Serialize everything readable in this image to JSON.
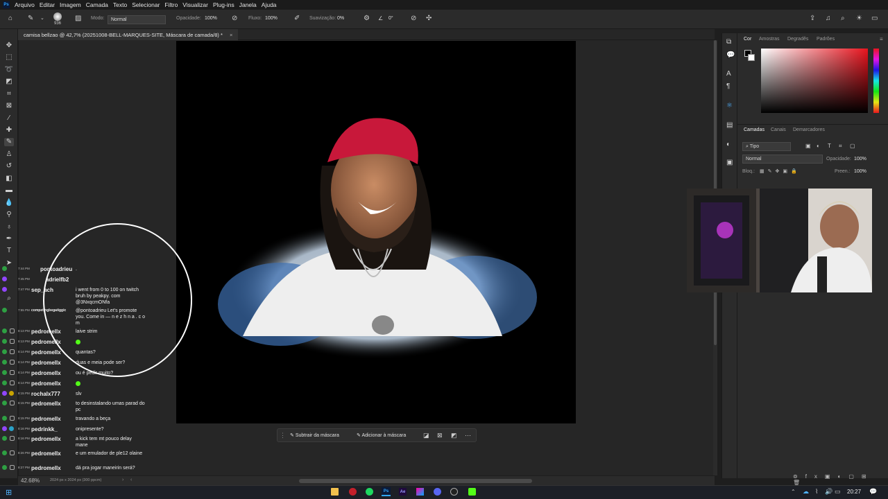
{
  "menu": [
    "Arquivo",
    "Editar",
    "Imagem",
    "Camada",
    "Texto",
    "Selecionar",
    "Filtro",
    "Visualizar",
    "Plug-ins",
    "Janela",
    "Ajuda"
  ],
  "options": {
    "brush_size": "936",
    "mode_label": "Modo:",
    "mode_value": "Normal",
    "opacity_label": "Opacidade:",
    "opacity_value": "100%",
    "flow_label": "Fluxo:",
    "flow_value": "100%",
    "smoothing_label": "Suavização:",
    "smoothing_value": "0%",
    "angle_value": "0°"
  },
  "document": {
    "tab_title": "camisa bellzao @ 42,7% (20251008-BELL-MARQUES-SITE, Máscara de camada/8) *",
    "zoom": "42.68%",
    "info": "2024 px x 2024 px (300 ppcm)"
  },
  "mask_toolbar": {
    "subtract": "Subtrair da máscara",
    "add": "Adicionar à máscara"
  },
  "color_panel": {
    "tabs": [
      "Cor",
      "Amostras",
      "Degradês",
      "Padrões"
    ],
    "hue_color": "#e8141e"
  },
  "layers_panel": {
    "tabs": [
      "Camadas",
      "Canais",
      "Demarcadores"
    ],
    "filter_type": "Tipo",
    "blend_mode": "Normal",
    "opacity_label": "Opacidade:",
    "opacity_value": "100%",
    "lock_label": "Bloq.:",
    "fill_label": "Preen.:",
    "fill_value": "100%"
  },
  "chat": [
    {
      "time": "7:44 PM",
      "user": "pontoadrieu",
      "msg": ".",
      "color": "#e0e0e0"
    },
    {
      "time": "7:45 PM",
      "user": "adrielfb2",
      "msg": "",
      "color": "#e0e0e0"
    },
    {
      "time": "7:47 PM",
      "user": "sep_ach",
      "msg": "i went from 0 to 100 on twitch bruh by peakpy. com      @3NxqcmONfa"
    },
    {
      "time": "7:55 PM",
      "user": "competingbegatiggic",
      "msg": "@pontoadrieu Let's promote you. Come in — n e z h n a . c o m"
    },
    {
      "time": "8:13 PM",
      "user": "pedromellx",
      "msg": "laive strim"
    },
    {
      "time": "8:13 PM",
      "user": "pedromellx",
      "msg": ""
    },
    {
      "time": "8:14 PM",
      "user": "pedromellx",
      "msg": "quantas?"
    },
    {
      "time": "8:14 PM",
      "user": "pedromellx",
      "msg": "duas e meia pode ser?"
    },
    {
      "time": "8:14 PM",
      "user": "pedromellx",
      "msg": "ou é pedir muito?"
    },
    {
      "time": "8:14 PM",
      "user": "pedromellx",
      "msg": ""
    },
    {
      "time": "8:15 PM",
      "user": "rochalx777",
      "msg": "slv"
    },
    {
      "time": "8:15 PM",
      "user": "pedromellx",
      "msg": "to desinstalando umas parad do pc"
    },
    {
      "time": "8:15 PM",
      "user": "pedromellx",
      "msg": "travando a beça"
    },
    {
      "time": "8:16 PM",
      "user": "pedrinkk_",
      "msg": "onipresente?"
    },
    {
      "time": "8:16 PM",
      "user": "pedromellx",
      "msg": "a kick tem mt pouco delay mane"
    },
    {
      "time": "8:26 PM",
      "user": "pedromellx",
      "msg": "e um emulador de ple12 olaine"
    },
    {
      "time": "8:27 PM",
      "user": "pedromellx",
      "msg": "dá pra jogar maneirin será?"
    }
  ],
  "taskbar": {
    "time": "20:27"
  }
}
